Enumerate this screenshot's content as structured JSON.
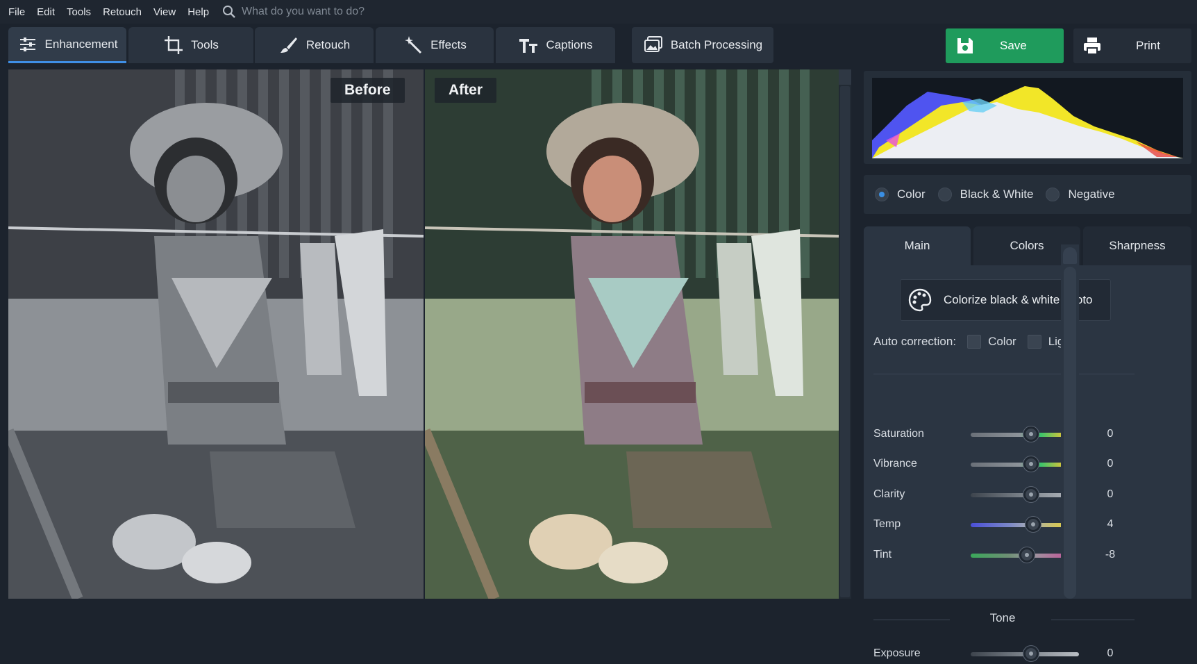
{
  "menu": [
    "File",
    "Edit",
    "Tools",
    "Retouch",
    "View",
    "Help"
  ],
  "search": {
    "placeholder": "What do you want to do?"
  },
  "tabs": [
    {
      "label": "Enhancement",
      "icon": "sliders-icon",
      "active": true
    },
    {
      "label": "Tools",
      "icon": "crop-icon",
      "active": false
    },
    {
      "label": "Retouch",
      "icon": "brush-icon",
      "active": false
    },
    {
      "label": "Effects",
      "icon": "magic-wand-icon",
      "active": false
    },
    {
      "label": "Captions",
      "icon": "text-icon",
      "active": false
    }
  ],
  "batch": {
    "label": "Batch Processing",
    "icon": "images-icon"
  },
  "save": {
    "label": "Save",
    "icon": "save-icon",
    "color": "#1f9b5c"
  },
  "print": {
    "label": "Print",
    "icon": "printer-icon"
  },
  "photo": {
    "before_label": "Before",
    "after_label": "After"
  },
  "modes": {
    "color": "Color",
    "bw": "Black & White",
    "negative": "Negative",
    "selected": "Color"
  },
  "subtabs": {
    "main": "Main",
    "colors": "Colors",
    "sharpness": "Sharpness",
    "active": "Main"
  },
  "colorize": {
    "label": "Colorize black & white photo",
    "icon": "palette-icon"
  },
  "auto_correction": {
    "label": "Auto correction:",
    "color": "Color",
    "light": "Light"
  },
  "sliders": [
    {
      "label": "Saturation",
      "value": "0"
    },
    {
      "label": "Vibrance",
      "value": "0"
    },
    {
      "label": "Clarity",
      "value": "0"
    },
    {
      "label": "Temp",
      "value": "4"
    },
    {
      "label": "Tint",
      "value": "-8"
    }
  ],
  "tone": {
    "title": "Tone"
  },
  "tone_sliders": [
    {
      "label": "Exposure",
      "value": "0"
    }
  ],
  "accent_color": "#3f8fe6"
}
